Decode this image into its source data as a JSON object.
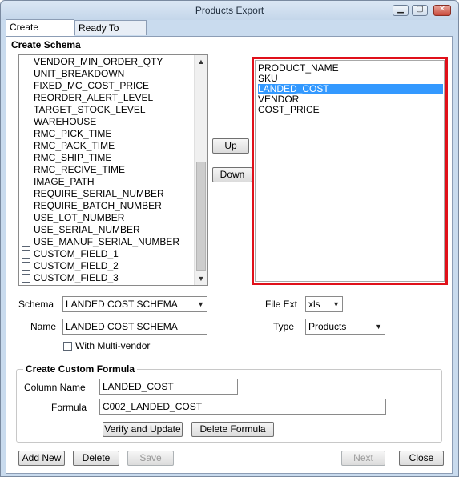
{
  "window": {
    "title": "Products Export"
  },
  "tabs": [
    {
      "label": "Create Schema"
    },
    {
      "label": "Ready To Export"
    }
  ],
  "create_schema": {
    "heading": "Create Schema",
    "field_list": [
      "VENDOR_MIN_ORDER_QTY",
      "UNIT_BREAKDOWN",
      "FIXED_MC_COST_PRICE",
      "REORDER_ALERT_LEVEL",
      "TARGET_STOCK_LEVEL",
      "WAREHOUSE",
      "RMC_PICK_TIME",
      "RMC_PACK_TIME",
      "RMC_SHIP_TIME",
      "RMC_RECIVE_TIME",
      "IMAGE_PATH",
      "REQUIRE_SERIAL_NUMBER",
      "REQUIRE_BATCH_NUMBER",
      "USE_LOT_NUMBER",
      "USE_SERIAL_NUMBER",
      "USE_MANUF_SERIAL_NUMBER",
      "CUSTOM_FIELD_1",
      "CUSTOM_FIELD_2",
      "CUSTOM_FIELD_3"
    ],
    "up_label": "Up",
    "down_label": "Down",
    "selected_fields": [
      "PRODUCT_NAME",
      "SKU",
      "LANDED_COST",
      "VENDOR",
      "COST_PRICE"
    ],
    "selected_index": 2
  },
  "form": {
    "schema_label": "Schema",
    "schema_value": "LANDED COST SCHEMA",
    "name_label": "Name",
    "name_value": "LANDED COST SCHEMA",
    "multivendor_label": "With Multi-vendor",
    "file_ext_label": "File Ext",
    "file_ext_value": "xls",
    "type_label": "Type",
    "type_value": "Products"
  },
  "custom_formula": {
    "heading": "Create Custom Formula",
    "column_name_label": "Column Name",
    "column_name_value": "LANDED_COST",
    "formula_label": "Formula",
    "formula_value": "C002_LANDED_COST",
    "verify_label": "Verify and Update",
    "delete_formula_label": "Delete Formula"
  },
  "footer": {
    "add_new": "Add New",
    "delete": "Delete",
    "save": "Save",
    "next": "Next",
    "close": "Close"
  },
  "colors": {
    "highlight": "#e0101a",
    "selection": "#3399ff"
  }
}
